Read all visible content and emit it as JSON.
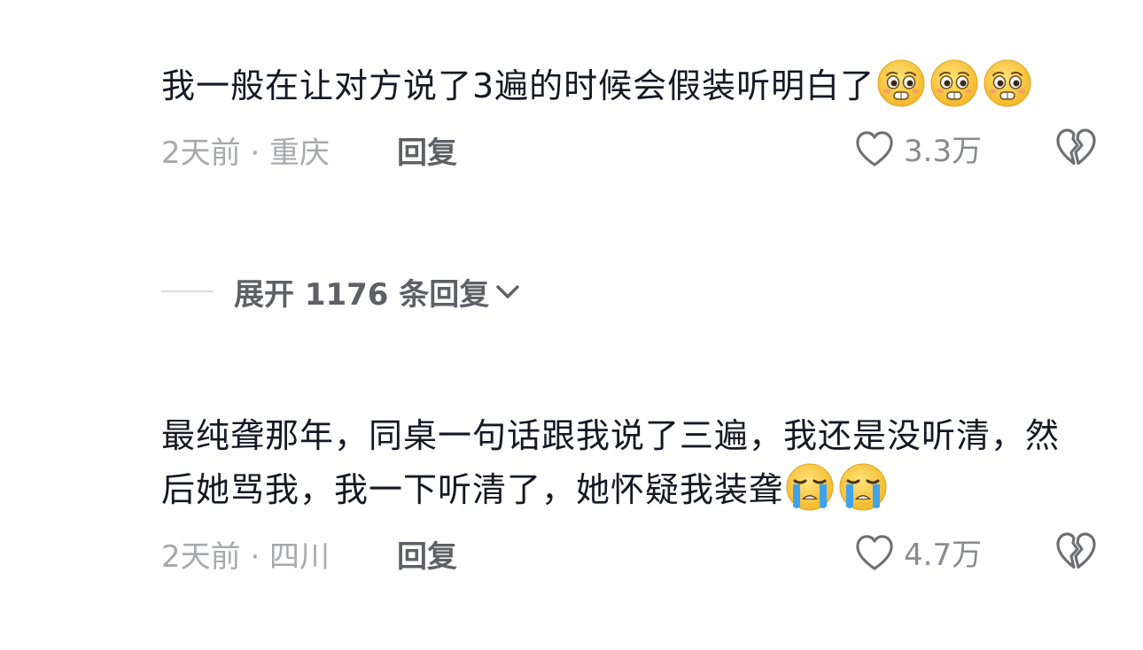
{
  "comments": [
    {
      "text": "我一般在让对方说了3遍的时候会假装听明白了",
      "trailing_emojis": [
        "pleading-face-icon",
        "pleading-face-icon",
        "pleading-face-icon"
      ],
      "time_location": "2天前 · 重庆",
      "reply_label": "回复",
      "like_count": "3.3万",
      "like_icon": "heart-outline-icon",
      "dislike_icon": "broken-heart-icon"
    },
    {
      "text": "最纯聋那年，同桌一句话跟我说了三遍，我还是没听清，然后她骂我，我一下听清了，她怀疑我装聋",
      "trailing_emojis": [
        "crying-face-icon",
        "crying-face-icon"
      ],
      "time_location": "2天前 · 四川",
      "reply_label": "回复",
      "like_count": "4.7万",
      "like_icon": "heart-outline-icon",
      "dislike_icon": "broken-heart-icon"
    }
  ],
  "expand_replies": {
    "label": "展开 1176 条回复",
    "icon": "chevron-down-icon"
  },
  "colors": {
    "text_primary": "#161823",
    "text_meta": "#a8a9ad",
    "text_action": "#5f6065",
    "emoji_face": "#f7c53a",
    "emoji_tear": "#3ea3ee"
  }
}
